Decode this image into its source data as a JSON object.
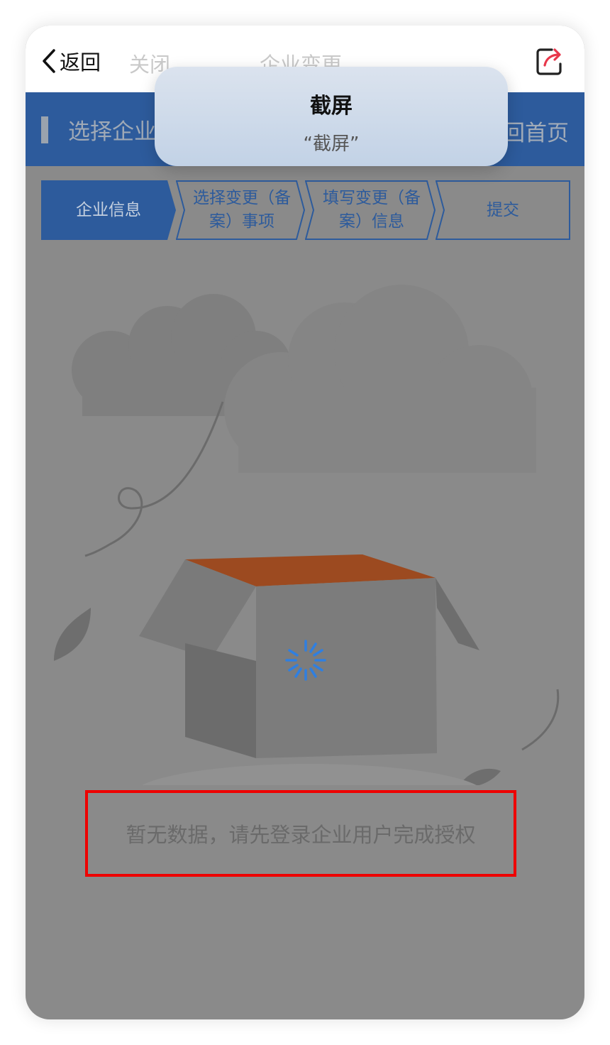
{
  "nav": {
    "back_label": "返回",
    "close_label": "关闭",
    "title": "企业变更",
    "share_icon": "share-icon"
  },
  "header": {
    "section_title": "选择企业",
    "home_label": "返回首页"
  },
  "steps": [
    {
      "label": "企业信息",
      "active": true
    },
    {
      "label": "选择变更（备案）事项",
      "active": false
    },
    {
      "label": "填写变更（备案）信息",
      "active": false
    },
    {
      "label": "提交",
      "active": false
    }
  ],
  "toast": {
    "title": "截屏",
    "subtitle": "“截屏”"
  },
  "empty": {
    "message": "暂无数据，请先登录企业用户完成授权"
  },
  "colors": {
    "brand_blue": "#2d5b9c",
    "overlay_gray": "#8a8a8a",
    "highlight_red": "#ee0000",
    "spinner_blue": "#2f7fe0"
  }
}
